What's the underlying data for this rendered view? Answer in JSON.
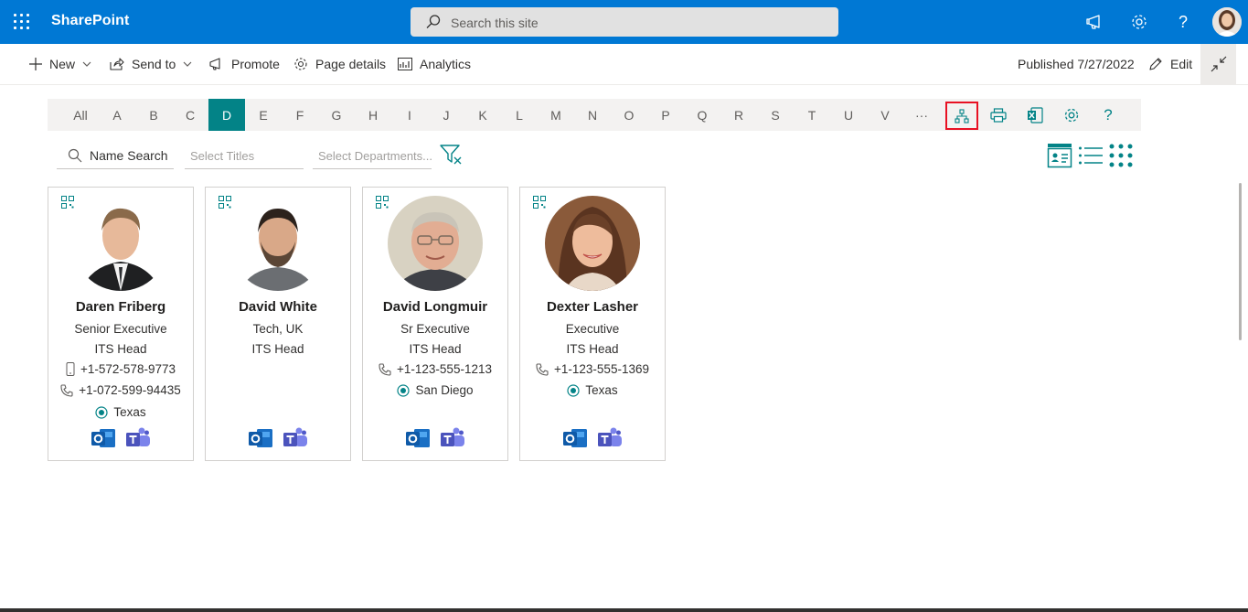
{
  "suite": {
    "brand": "SharePoint",
    "search_placeholder": "Search this site",
    "icons": [
      "waffle-icon",
      "megaphone-icon",
      "gear-icon",
      "help-icon",
      "avatar"
    ]
  },
  "commands": {
    "new": "New",
    "send_to": "Send to",
    "promote": "Promote",
    "page_details": "Page details",
    "analytics": "Analytics",
    "published": "Published 7/27/2022",
    "edit": "Edit"
  },
  "letters": [
    "All",
    "A",
    "B",
    "C",
    "D",
    "E",
    "F",
    "G",
    "H",
    "I",
    "J",
    "K",
    "L",
    "M",
    "N",
    "O",
    "P",
    "Q",
    "R",
    "S",
    "T",
    "U",
    "V",
    "···"
  ],
  "active_letter": "D",
  "toolbar_icons": [
    "org-chart-icon",
    "print-icon",
    "excel-icon",
    "settings-icon",
    "help-icon"
  ],
  "filters": {
    "name_search": "Name Search",
    "titles_placeholder": "Select Titles",
    "departments_placeholder": "Select Departments..."
  },
  "views": [
    "card-view-icon",
    "list-view-icon",
    "grid-view-icon"
  ],
  "colors": {
    "suite_bar": "#0078d4",
    "accent_teal": "#038387",
    "highlight_border": "#e81123"
  },
  "people": [
    {
      "name": "Daren Friberg",
      "title": "Senior Executive",
      "department": "ITS Head",
      "mobile": "+1-572-578-9773",
      "phone": "+1-072-599-94435",
      "location": "Texas"
    },
    {
      "name": "David White",
      "title": "Tech, UK",
      "department": "ITS Head",
      "mobile": "",
      "phone": "",
      "location": ""
    },
    {
      "name": "David Longmuir",
      "title": "Sr Executive",
      "department": "ITS Head",
      "mobile": "",
      "phone": "+1-123-555-1213",
      "location": "San Diego"
    },
    {
      "name": "Dexter Lasher",
      "title": "Executive",
      "department": "ITS Head",
      "mobile": "",
      "phone": "+1-123-555-1369",
      "location": "Texas"
    }
  ]
}
